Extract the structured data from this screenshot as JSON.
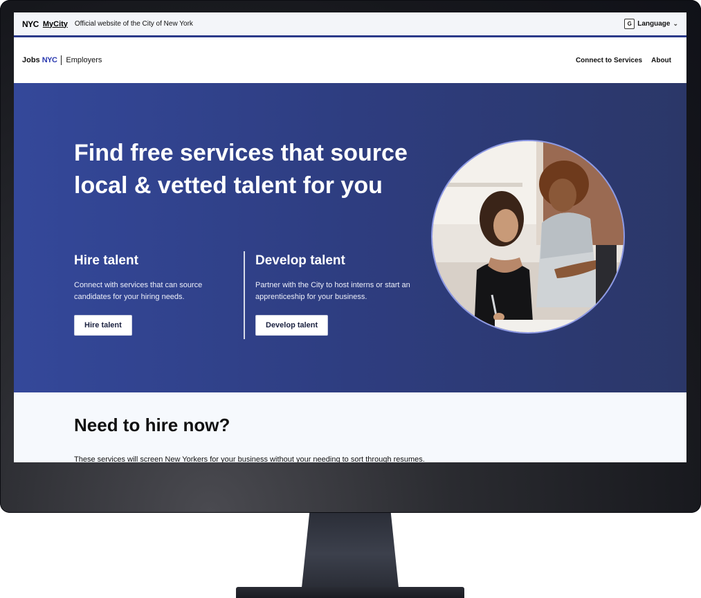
{
  "topbar": {
    "nyc_logo": "NYC",
    "mycity": "MyCity",
    "official_text": "Official website of the City of New York",
    "language_label": "Language",
    "language_icon": "translate-icon"
  },
  "nav": {
    "brand_jobs": "Jobs",
    "brand_nyc": "NYC",
    "brand_section": "Employers",
    "links": [
      "Connect to Services",
      "About"
    ]
  },
  "hero": {
    "title": "Find free services that source local & vetted talent for you",
    "hire": {
      "heading": "Hire talent",
      "text": "Connect with services that can source candidates for your hiring needs.",
      "button": "Hire talent"
    },
    "develop": {
      "heading": "Develop talent",
      "text": "Partner with the City to host interns or start an apprenticeship for your business.",
      "button": "Develop talent"
    }
  },
  "section2": {
    "title": "Need to hire now?",
    "text": "These services will screen New Yorkers for your business without your needing to sort through resumes."
  },
  "colors": {
    "brand_blue": "#2b3ab0",
    "hero_bg": "#2e3d80",
    "section_bg": "#f6f9fd"
  }
}
